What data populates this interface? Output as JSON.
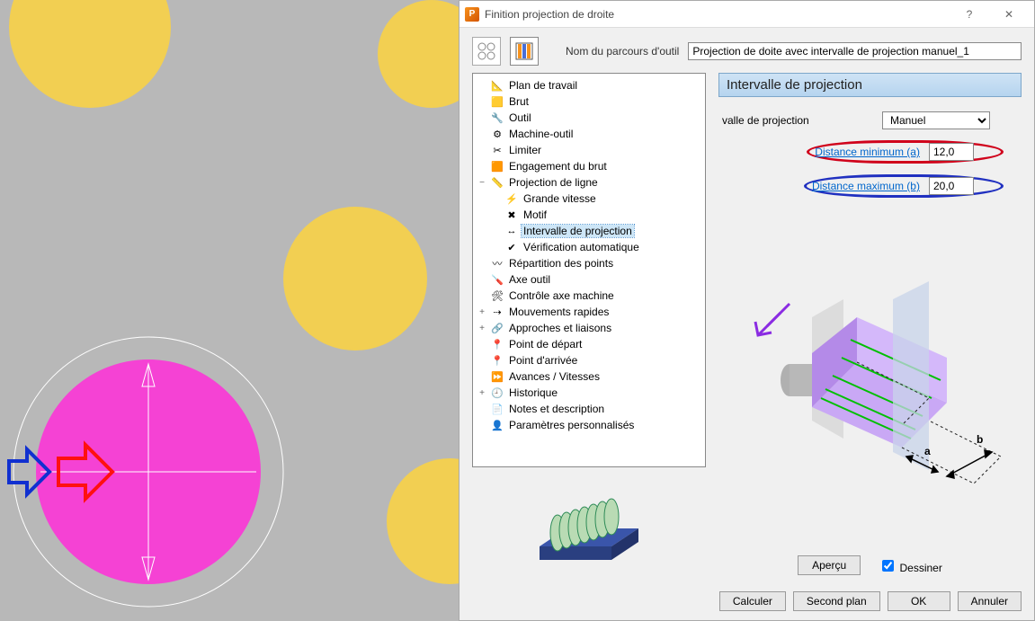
{
  "window": {
    "title": "Finition projection de droite"
  },
  "toolpath_name": {
    "label": "Nom du parcours d'outil",
    "value": "Projection de doite avec intervalle de projection manuel_1"
  },
  "tree": [
    {
      "label": "Plan de travail",
      "lvl": 0,
      "exp": ""
    },
    {
      "label": "Brut",
      "lvl": 0,
      "exp": ""
    },
    {
      "label": "Outil",
      "lvl": 0,
      "exp": ""
    },
    {
      "label": "Machine-outil",
      "lvl": 0,
      "exp": ""
    },
    {
      "label": "Limiter",
      "lvl": 0,
      "exp": ""
    },
    {
      "label": "Engagement du brut",
      "lvl": 0,
      "exp": ""
    },
    {
      "label": "Projection de ligne",
      "lvl": 0,
      "exp": "−"
    },
    {
      "label": "Grande vitesse",
      "lvl": 1,
      "exp": ""
    },
    {
      "label": "Motif",
      "lvl": 1,
      "exp": ""
    },
    {
      "label": "Intervalle de projection",
      "lvl": 1,
      "exp": "",
      "selected": true
    },
    {
      "label": "Vérification automatique",
      "lvl": 1,
      "exp": ""
    },
    {
      "label": "Répartition des points",
      "lvl": 0,
      "exp": ""
    },
    {
      "label": "Axe outil",
      "lvl": 0,
      "exp": ""
    },
    {
      "label": "Contrôle axe machine",
      "lvl": 0,
      "exp": ""
    },
    {
      "label": "Mouvements rapides",
      "lvl": 0,
      "exp": "+"
    },
    {
      "label": "Approches et liaisons",
      "lvl": 0,
      "exp": "+"
    },
    {
      "label": "Point de départ",
      "lvl": 0,
      "exp": ""
    },
    {
      "label": "Point d'arrivée",
      "lvl": 0,
      "exp": ""
    },
    {
      "label": "Avances / Vitesses",
      "lvl": 0,
      "exp": ""
    },
    {
      "label": "Historique",
      "lvl": 0,
      "exp": "+"
    },
    {
      "label": "Notes et description",
      "lvl": 0,
      "exp": ""
    },
    {
      "label": "Paramètres personnalisés",
      "lvl": 0,
      "exp": ""
    }
  ],
  "panel": {
    "title": "Intervalle de projection",
    "mode_label": "valle de projection",
    "mode_value": "Manuel",
    "min": {
      "label": "Distance minimum (a)",
      "value": "12,0"
    },
    "max": {
      "label": "Distance maximum (b)",
      "value": "20,0"
    },
    "diagram_labels": {
      "a": "a",
      "b": "b"
    }
  },
  "preview": {
    "apercu": "Aperçu",
    "dessiner": "Dessiner"
  },
  "buttons": {
    "calculer": "Calculer",
    "second_plan": "Second plan",
    "ok": "OK",
    "annuler": "Annuler"
  }
}
